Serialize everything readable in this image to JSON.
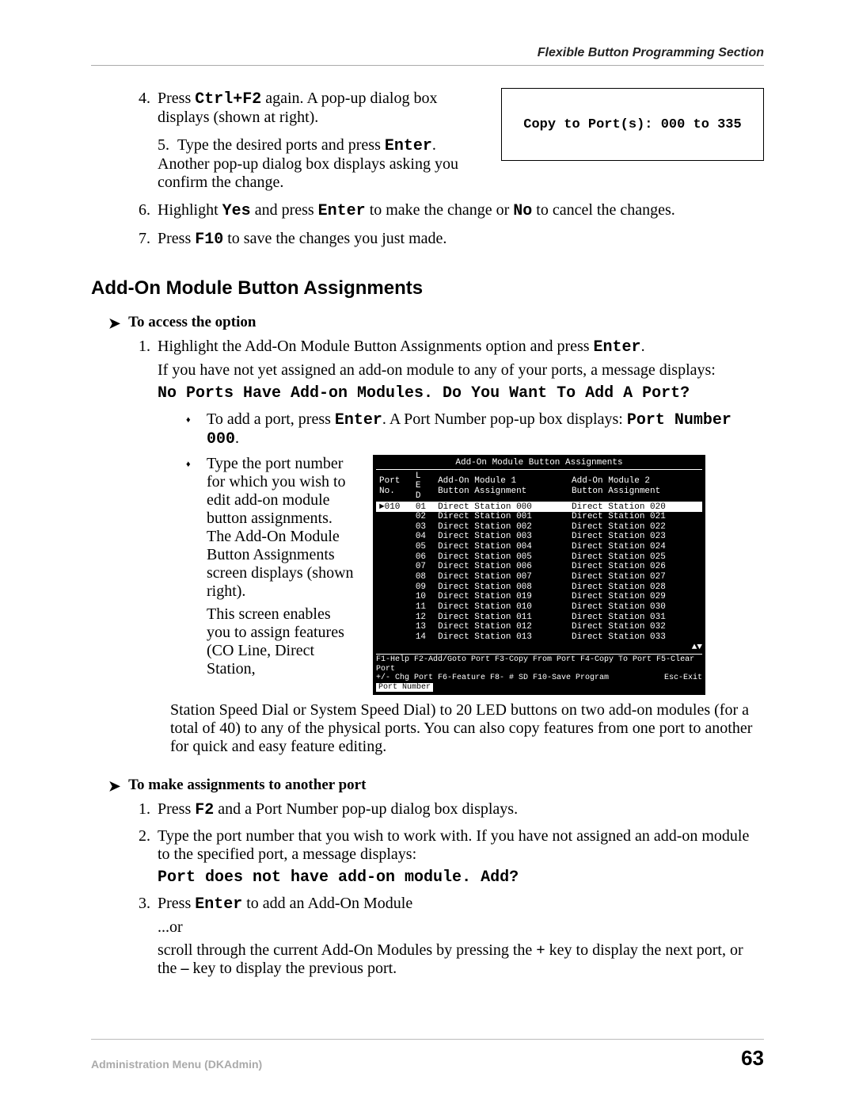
{
  "running_head": "Flexible Button Programming Section",
  "steps_top": {
    "s4_a": "Press ",
    "s4_key": "Ctrl+F2",
    "s4_b": " again. A pop-up dialog box displays (shown at right).",
    "s5_a": "Type the desired ports and press ",
    "s5_key": "Enter",
    "s5_b": ". Another pop-up dialog box displays asking you confirm the change.",
    "s6_a": "Highlight ",
    "s6_yes": "Yes",
    "s6_b": " and press ",
    "s6_enter": "Enter",
    "s6_c": " to make the change or ",
    "s6_no": "No",
    "s6_d": " to cancel the changes.",
    "s7_a": "Press ",
    "s7_key": "F10",
    "s7_b": " to save the changes you just made."
  },
  "popup": "Copy to Port(s): 000 to 335",
  "section_heading": "Add-On Module Button Assignments",
  "proc1_title": "To access the option",
  "proc1": {
    "p1_a": "Highlight the Add-On Module Button Assignments option and press ",
    "p1_key": "Enter",
    "p1_b": ".",
    "p2": "If you have not yet assigned an add-on module to any of your ports, a message displays:",
    "p2_code": "No Ports Have Add-on Modules. Do You Want To Add A Port?",
    "b1_a": "To add a port, press ",
    "b1_key": "Enter",
    "b1_b": ". A Port Number pop-up box displays: ",
    "b1_code": "Port Number 000",
    "b1_dot": ".",
    "b2_a": "Type the port number for which you wish to edit add-on module button assignments. The Add-On Module Button Assignments screen displays (shown right).",
    "b2_b": "This screen enables you to assign features (CO Line, Direct Station,",
    "after": "Station Speed Dial or System Speed Dial) to 20 LED buttons on two add-on modules (for a total of 40) to any of the physical ports. You can also copy features from one port to another for quick and easy feature editing."
  },
  "terminal": {
    "title": "Add-On Module Button Assignments",
    "hdr_port": "Port\nNo.",
    "hdr_led": "L\nE\nD",
    "hdr_m1a": "Add-On Module 1",
    "hdr_m1b": "Button Assignment",
    "hdr_m2a": "Add-On Module 2",
    "hdr_m2b": "Button Assignment",
    "port_sel": "►010",
    "rows": [
      {
        "led": "01",
        "m1": "Direct Station 000",
        "m2": "Direct Station 020"
      },
      {
        "led": "02",
        "m1": "Direct Station 001",
        "m2": "Direct Station 021"
      },
      {
        "led": "03",
        "m1": "Direct Station 002",
        "m2": "Direct Station 022"
      },
      {
        "led": "04",
        "m1": "Direct Station 003",
        "m2": "Direct Station 023"
      },
      {
        "led": "05",
        "m1": "Direct Station 004",
        "m2": "Direct Station 024"
      },
      {
        "led": "06",
        "m1": "Direct Station 005",
        "m2": "Direct Station 025"
      },
      {
        "led": "07",
        "m1": "Direct Station 006",
        "m2": "Direct Station 026"
      },
      {
        "led": "08",
        "m1": "Direct Station 007",
        "m2": "Direct Station 027"
      },
      {
        "led": "09",
        "m1": "Direct Station 008",
        "m2": "Direct Station 028"
      },
      {
        "led": "10",
        "m1": "Direct Station 019",
        "m2": "Direct Station 029"
      },
      {
        "led": "11",
        "m1": "Direct Station 010",
        "m2": "Direct Station 030"
      },
      {
        "led": "12",
        "m1": "Direct Station 011",
        "m2": "Direct Station 031"
      },
      {
        "led": "13",
        "m1": "Direct Station 012",
        "m2": "Direct Station 032"
      },
      {
        "led": "14",
        "m1": "Direct Station 013",
        "m2": "Direct Station 033"
      }
    ],
    "foot1": "F1-Help  F2-Add/Goto Port  F3-Copy From Port  F4-Copy To Port  F5-Clear Port",
    "foot2": "+/- Chg Port  F6-Feature  F8- # SD  F10-Save Program",
    "foot_esc": "Esc-Exit",
    "foot3": "Port Number"
  },
  "proc2_title": "To make assignments to another port",
  "proc2": {
    "s1_a": "Press ",
    "s1_key": "F2",
    "s1_b": " and a Port Number pop-up dialog box displays.",
    "s2": "Type the port number that you wish to work with. If you have not assigned an add-on module to the specified port, a message displays:",
    "s2_code": "Port does not have add-on module. Add?",
    "s3_a": "Press ",
    "s3_key": "Enter",
    "s3_b": " to add an Add-On Module",
    "s3_or": "...or",
    "s3_c1": "scroll through the current Add-On Modules by pressing the ",
    "s3_plus": "+",
    "s3_c2": " key to display the next port, or the ",
    "s3_minus": "–",
    "s3_c3": " key to display the previous port."
  },
  "footer_left": "Administration Menu (DKAdmin)",
  "footer_right": "63"
}
